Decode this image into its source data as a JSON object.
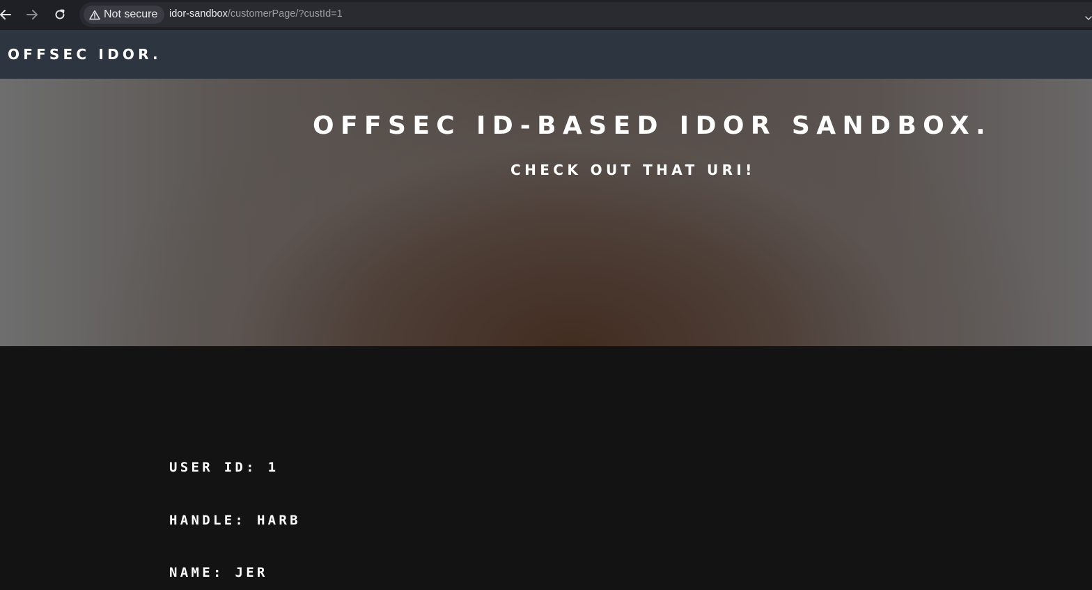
{
  "browser": {
    "security_label": "Not secure",
    "url_host": "idor-sandbox",
    "url_path": "/customerPage/?custId=1",
    "icons": {
      "back": "arrow-left-icon",
      "forward": "arrow-right-icon",
      "reload": "reload-icon",
      "security": "warning-triangle-icon",
      "omnibox_menu": "chevron-down-icon"
    }
  },
  "navbar": {
    "brand": "OFFSEC IDOR."
  },
  "hero": {
    "title": "OFFSEC ID-BASED IDOR SANDBOX.",
    "subtitle": "CHECK OUT THAT URI!"
  },
  "customer": {
    "user_id_label": "USER ID:",
    "user_id_value": "1",
    "handle_label": "HANDLE:",
    "handle_value": "HARB",
    "name_label": "NAME:",
    "name_value": "JER"
  },
  "colors": {
    "browser_bar": "#1f2026",
    "navbar": "#2c3540",
    "page_background": "#131313",
    "text": "#ffffff"
  }
}
